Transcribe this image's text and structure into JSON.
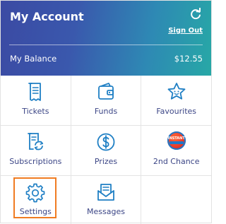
{
  "header": {
    "title": "My Account",
    "refresh_icon": "refresh-icon",
    "sign_out_label": "Sign Out",
    "balance_label": "My Balance",
    "balance_value": "$12.55"
  },
  "menu": {
    "items": [
      {
        "label": "Tickets",
        "icon": "ticket-icon"
      },
      {
        "label": "Funds",
        "icon": "wallet-icon"
      },
      {
        "label": "Favourites",
        "icon": "star-icon"
      },
      {
        "label": "Subscriptions",
        "icon": "subscriptions-icon"
      },
      {
        "label": "Prizes",
        "icon": "dollar-icon"
      },
      {
        "label": "2nd Chance",
        "icon": "instant-badge-icon"
      },
      {
        "label": "Settings",
        "icon": "gear-icon"
      },
      {
        "label": "Messages",
        "icon": "message-icon"
      }
    ]
  },
  "badge": {
    "text": "INSTANT"
  },
  "colors": {
    "header_gradient_start": "#3b4aa3",
    "header_gradient_end": "#27a8a6",
    "icon": "#1f7fc4",
    "label": "#3c4686",
    "highlight": "#f07c22"
  }
}
